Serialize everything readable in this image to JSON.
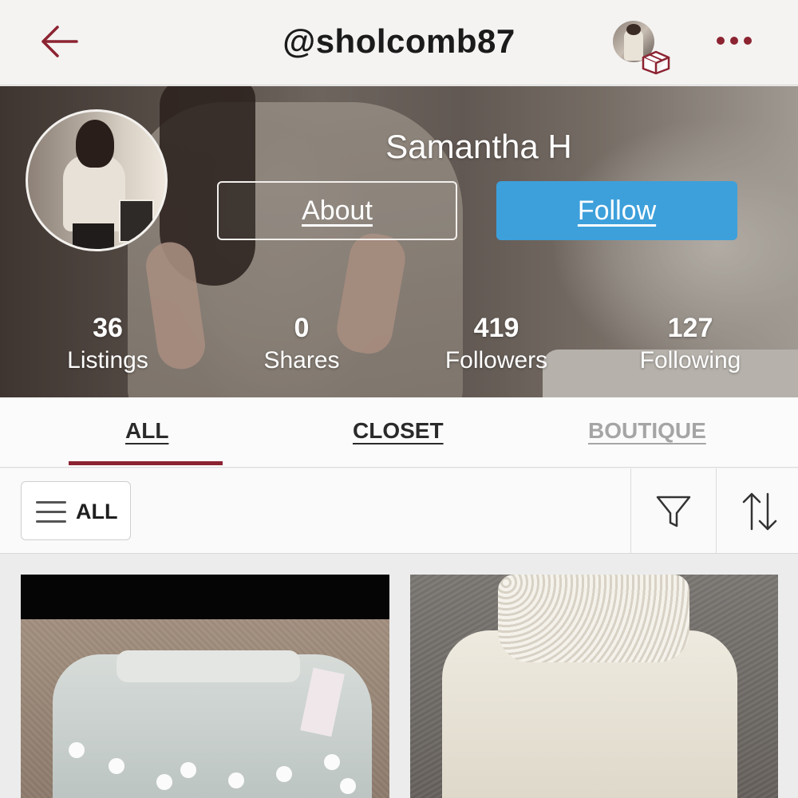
{
  "header": {
    "username": "@sholcomb87"
  },
  "profile": {
    "name": "Samantha H",
    "about_label": "About",
    "follow_label": "Follow"
  },
  "stats": [
    {
      "value": "36",
      "label": "Listings"
    },
    {
      "value": "0",
      "label": "Shares"
    },
    {
      "value": "419",
      "label": "Followers"
    },
    {
      "value": "127",
      "label": "Following"
    }
  ],
  "tabs": [
    {
      "label": "ALL",
      "active": true
    },
    {
      "label": "CLOSET",
      "active": false
    },
    {
      "label": "BOUTIQUE",
      "active": false
    }
  ],
  "filter": {
    "dropdown_label": "ALL"
  },
  "icons": {
    "back": "back-arrow-icon",
    "bundle": "box-icon",
    "more": "more-icon",
    "filter": "filter-funnel-icon",
    "sort": "sort-arrows-icon",
    "menu": "hamburger-menu-icon"
  },
  "colors": {
    "accent": "#8c2331",
    "follow_button": "#3da0db"
  }
}
